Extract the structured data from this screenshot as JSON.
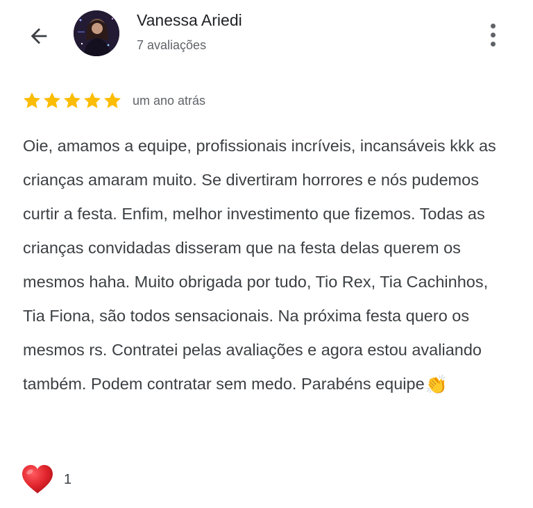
{
  "header": {
    "back_icon": "arrow-left-icon",
    "reviewer_name": "Vanessa Ariedi",
    "review_count": "7 avaliações",
    "more_icon": "more-vertical-icon"
  },
  "review": {
    "rating": 5,
    "max_rating": 5,
    "star_color": "#fbbc04",
    "date": "um ano atrás",
    "text": "Oie, amamos a equipe, profissionais incríveis, incansáveis kkk as crianças amaram muito. Se divertiram horrores e nós pudemos curtir a festa. Enfim, melhor investimento que fizemos. Todas as crianças convidadas disseram que na festa delas querem os mesmos haha. Muito obrigada por tudo, Tio Rex, Tia Cachinhos, Tia Fiona, são todos sensacionais. Na próxima festa quero os mesmos rs. Contratei pelas avaliações e agora estou avaliando também. Podem contratar sem medo. Parabéns equipe",
    "text_emoji": "👏"
  },
  "reaction": {
    "icon": "heart-icon",
    "color": "#e0242b",
    "count": "1"
  }
}
